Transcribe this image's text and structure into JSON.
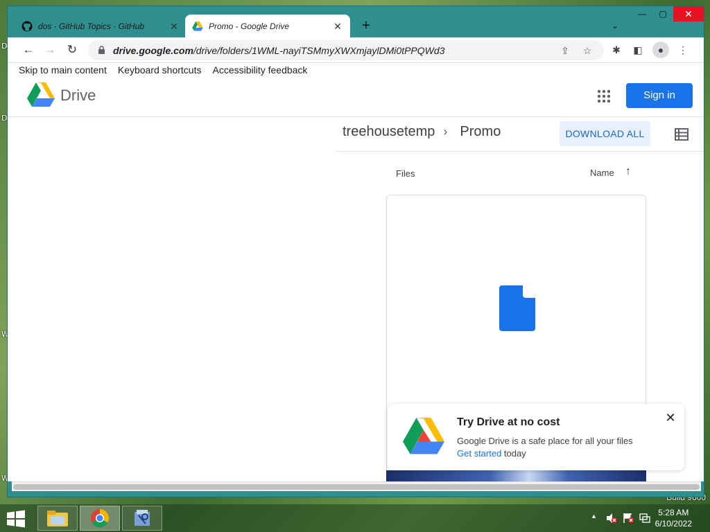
{
  "desktop": {
    "left_letters": [
      "D",
      "D",
      "W",
      "W"
    ],
    "build_text": "Build 9600"
  },
  "browser": {
    "tabs": [
      {
        "title": "dos · GitHub Topics · GitHub",
        "icon": "github-icon",
        "active": false
      },
      {
        "title": "Promo - Google Drive",
        "icon": "drive-icon",
        "active": true
      }
    ],
    "new_tab_label": "+",
    "tab_search_label": "⌄",
    "window_controls": {
      "minimize": "—",
      "maximize": "▢",
      "close": "✕"
    },
    "nav": {
      "back": "←",
      "forward": "→",
      "reload": "↻"
    },
    "url_host": "drive.google.com",
    "url_path": "/drive/folders/1WML-nayiTSMmyXWXmjaylDMi0tPPQWd3",
    "omnibox_actions": {
      "share": "⇪",
      "bookmark": "☆"
    },
    "toolbar_actions": {
      "extensions": "✱",
      "sidepanel": "◧",
      "profile": "●",
      "menu": "⋮"
    }
  },
  "page": {
    "skip_links": [
      "Skip to main content",
      "Keyboard shortcuts",
      "Accessibility feedback"
    ],
    "header": {
      "product_name": "Drive",
      "sign_in_label": "Sign in"
    },
    "breadcrumb": {
      "parent": "treehousetemp",
      "separator": "›",
      "current": "Promo"
    },
    "download_all_label": "DOWNLOAD ALL",
    "files_section_label": "Files",
    "sort_label": "Name",
    "sort_arrow": "↑",
    "promo": {
      "title": "Try Drive at no cost",
      "body": "Google Drive is a safe place for all your files",
      "link_text": "Get started",
      "link_suffix": " today",
      "close_label": "✕"
    }
  },
  "taskbar": {
    "items": [
      "file-explorer",
      "chrome",
      "archive-tool"
    ],
    "clock_time": "5:28 AM",
    "clock_date": "6/10/2022",
    "tray_up_arrow": "▲"
  },
  "colors": {
    "accent_blue": "#1a73e8",
    "download_bg": "#e8f0fe",
    "file_icon_blue": "#1a73e8",
    "window_frame": "#2f8f8f",
    "close_red": "#e81123"
  }
}
